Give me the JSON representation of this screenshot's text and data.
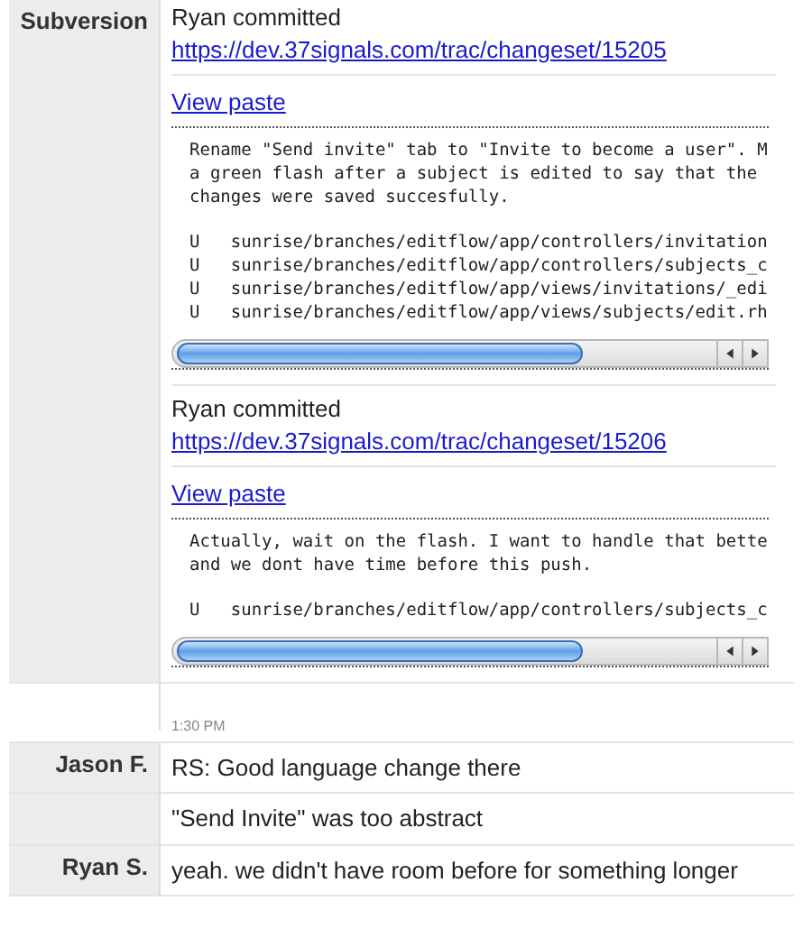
{
  "messages": [
    {
      "kind": "commits",
      "author": "Subversion",
      "commits": [
        {
          "headline": "Ryan committed",
          "url": "https://dev.37signals.com/trac/changeset/15205",
          "paste_link": "View paste",
          "paste_blocks": [
            [
              "Rename \"Send invite\" tab to \"Invite to become a user\". M",
              "a green flash after a subject is edited to say that the",
              "changes were saved succesfully."
            ],
            [
              "U   sunrise/branches/editflow/app/controllers/invitation",
              "U   sunrise/branches/editflow/app/controllers/subjects_c",
              "U   sunrise/branches/editflow/app/views/invitations/_edi",
              "U   sunrise/branches/editflow/app/views/subjects/edit.rh"
            ]
          ]
        },
        {
          "headline": "Ryan committed",
          "url": "https://dev.37signals.com/trac/changeset/15206",
          "paste_link": "View paste",
          "paste_blocks": [
            [
              "Actually, wait on the flash. I want to handle that bette",
              "and we dont have time before this push."
            ],
            [
              "U   sunrise/branches/editflow/app/controllers/subjects_c"
            ]
          ]
        }
      ]
    },
    {
      "kind": "timestamp",
      "time": "1:30 PM"
    },
    {
      "kind": "text",
      "author": "Jason F.",
      "text": "RS: Good language change there"
    },
    {
      "kind": "text",
      "text": "\"Send Invite\" was too abstract"
    },
    {
      "kind": "text",
      "author": "Ryan S.",
      "text": "yeah. we didn't have room before for something longer"
    }
  ]
}
